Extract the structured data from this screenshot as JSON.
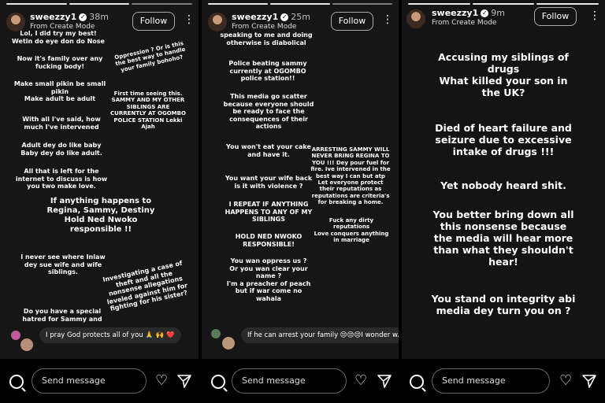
{
  "common": {
    "username": "sweezzy1",
    "source": "From Create Mode",
    "follow_label": "Follow",
    "more_glyph": "⋮",
    "verified_glyph": "✓",
    "message_placeholder": "Send message",
    "heart_glyph": "♡"
  },
  "panels": [
    {
      "time": "38m",
      "texts": [
        "Lol, I did try my best!\nWetin do eye don do Nose",
        "Now it's family over any\nfucking body!",
        "Make small pikin be small\npikin\nMake adult be adult",
        "With all I've said, how\nmuch I've intervened",
        "Adult dey do like baby\nBaby dey do like adult.",
        "All that is left for the\ninternet to discuss is how\nyou two make love.",
        "If anything happens to\nRegina, Sammy, Destiny\nHold Ned Nwoko\nresponsible !!",
        "I never see where Inlaw\ndey sue wife and wife\nsiblings.",
        "Do you have a special\nhatred for Sammy and",
        "Oppression ? Or is this\nthe best way to handle\nyour family bohoho?",
        "First time seeing this.\nSAMMY AND MY OTHER\nSIBLINGS ARE\nCURRENTLY AT OGOMBO\nPOLICE STATION Lekki\nAjah",
        "Investigating a case of\ntheft and all the\nnonsense allegations\nleveled against him for\nfighting for his sister?"
      ],
      "comment": "I pray God protects all of you 🙏 🙌 ❤️"
    },
    {
      "time": "25m",
      "texts": [
        "speaking to me and doing\notherwise is diabolical",
        "Police beating sammy\ncurrently at OGOMBO\npolice station!!",
        "This media go scatter\nbecause everyone should\nbe ready to face the\nconsequences of their\nactions",
        "You won't eat your cake\nand have it.",
        "You want your wife back\nis it with violence ?",
        "I REPEAT IF ANYTHING\nHAPPENS TO ANY OF MY\nSIBLINGS",
        "HOLD NED NWOKO\nRESPONSIBLE!",
        "You wan oppress us ?\nOr you wan clear your\nname ?\nI'm a preacher of peach\nbut if war come no\nwahala",
        "ARRESTING SAMMY WILL\nNEVER BRING REGINA TO\nYOU !!! Dey pour fuel for\nfire. Ive intervened in the\nbest way I can but atp\nLet everyone protect\ntheir reputations as\nreputations are criteria's\nfor breaking a home.",
        "Fuck any dirty\nreputations\nLove conquers anything\nin marriage"
      ],
      "comment": "If he can arrest your family 😒😒😒I wonder w..."
    },
    {
      "time": "9m",
      "texts": [
        "Accusing my siblings of\ndrugs\nWhat killed your son in\nthe UK?",
        "Died of heart failure and\nseizure due to excessive\nintake of drugs !!!",
        "Yet nobody heard shit.",
        "You better bring down all\nthis nonsense because\nthe media will hear more\nthan what they shouldn't\nhear!",
        "You stand on integrity abi\nmedia dey turn you on ?"
      ]
    }
  ]
}
